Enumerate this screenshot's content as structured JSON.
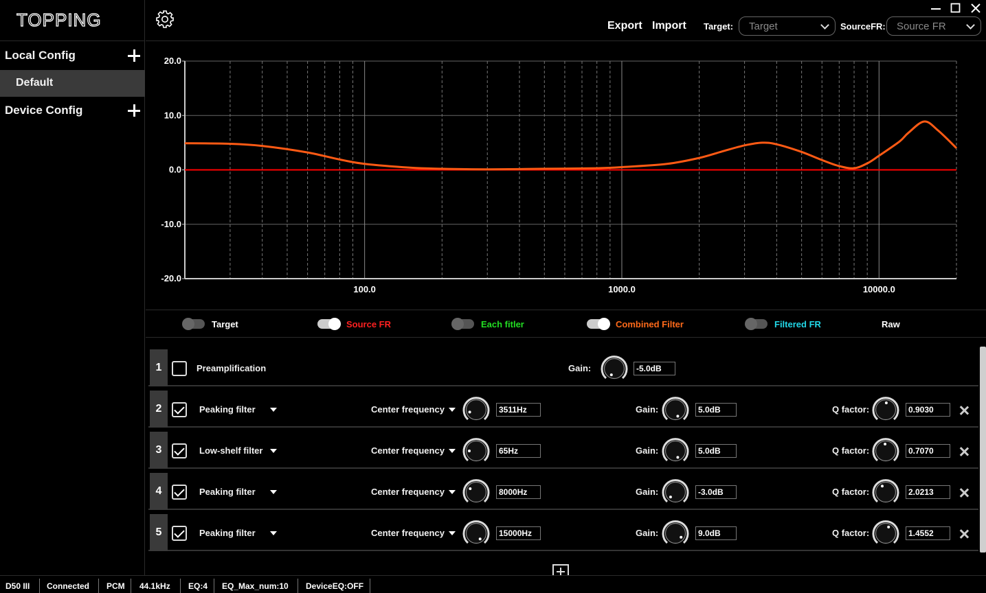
{
  "app": {
    "logo": "TOPPING"
  },
  "sidebar": {
    "local_config": "Local Config",
    "default_item": "Default",
    "device_config": "Device Config"
  },
  "toolbar": {
    "export": "Export",
    "import": "Import",
    "target_label": "Target:",
    "target_value": "Target",
    "source_label": "SourceFR:",
    "source_value": "Source FR"
  },
  "chart_data": {
    "type": "line",
    "xscale": "log",
    "xlim": [
      20,
      20000
    ],
    "ylim": [
      -20,
      20
    ],
    "x_ticks": [
      "100.0",
      "1000.0",
      "10000.0"
    ],
    "y_ticks": [
      "20.0",
      "10.0",
      "0.0",
      "-10.0",
      "-20.0"
    ],
    "grid": true,
    "series": [
      {
        "color": "#ff0000",
        "x": [
          20,
          20000
        ],
        "y": [
          0,
          0
        ]
      },
      {
        "color": "#ff5a14",
        "x": [
          20,
          30,
          40,
          60,
          80,
          100,
          150,
          200,
          300,
          500,
          800,
          1000,
          1500,
          2000,
          2500,
          3000,
          3511,
          4000,
          5000,
          6000,
          7000,
          8000,
          9000,
          10000,
          12000,
          13000,
          15000,
          17000,
          20000
        ],
        "y": [
          4.9,
          4.8,
          4.4,
          3.2,
          1.9,
          1.1,
          0.4,
          0.2,
          0.1,
          0.2,
          0.3,
          0.5,
          1.1,
          2.2,
          3.5,
          4.5,
          5.0,
          4.7,
          3.3,
          1.8,
          0.7,
          0.3,
          1.2,
          2.6,
          5.2,
          6.8,
          8.9,
          7.2,
          4.0
        ]
      }
    ]
  },
  "legend": {
    "target": "Target",
    "source_fr": "Source FR",
    "each_filter": "Each fitler",
    "combined_filter": "Combined Filter",
    "filtered_fr": "Filtered FR",
    "raw": "Raw"
  },
  "filters": [
    {
      "num": "1",
      "checked": false,
      "label": "Preamplification",
      "gain_label": "Gain:",
      "gain": "-5.0dB"
    },
    {
      "num": "2",
      "checked": true,
      "type": "Peaking filter",
      "freq_label": "Center frequency",
      "freq": "3511Hz",
      "gain_label": "Gain:",
      "gain": "5.0dB",
      "q_label": "Q factor:",
      "q": "0.9030"
    },
    {
      "num": "3",
      "checked": true,
      "type": "Low-shelf filter",
      "freq_label": "Center frequency",
      "freq": "65Hz",
      "gain_label": "Gain:",
      "gain": "5.0dB",
      "q_label": "Q factor:",
      "q": "0.7070"
    },
    {
      "num": "4",
      "checked": true,
      "type": "Peaking filter",
      "freq_label": "Center frequency",
      "freq": "8000Hz",
      "gain_label": "Gain:",
      "gain": "-3.0dB",
      "q_label": "Q factor:",
      "q": "2.0213"
    },
    {
      "num": "5",
      "checked": true,
      "type": "Peaking filter",
      "freq_label": "Center frequency",
      "freq": "15000Hz",
      "gain_label": "Gain:",
      "gain": "9.0dB",
      "q_label": "Q factor:",
      "q": "1.4552"
    }
  ],
  "status": [
    "D50 III",
    "Connected",
    "PCM",
    "44.1kHz",
    "EQ:4",
    "EQ_Max_num:10",
    "DeviceEQ:OFF"
  ]
}
